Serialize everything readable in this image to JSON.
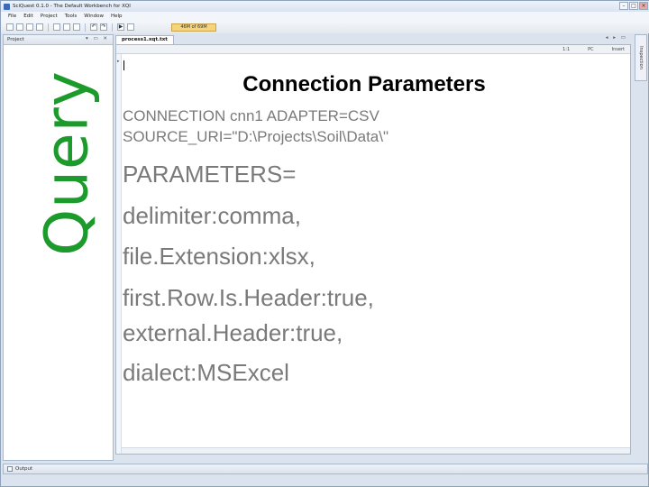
{
  "window": {
    "title": "SciQuest 0.1.0 - The Default Workbench for XQI"
  },
  "menu": [
    "File",
    "Edit",
    "Project",
    "Tools",
    "Window",
    "Help"
  ],
  "toolbar": {
    "memory": "46M of 69M"
  },
  "project_panel": {
    "title": "Project",
    "watermark": "Query"
  },
  "editor": {
    "tab_label": "process1.xqt.txt",
    "status": {
      "position": "1:1",
      "mode": "PC",
      "insert": "Insert"
    },
    "title": "Connection Parameters",
    "connection_lines": [
      "CONNECTION cnn1 ADAPTER=CSV",
      "SOURCE_URI=\"D:\\Projects\\Soil\\Data\\\""
    ],
    "parameter_lines": [
      "PARAMETERS=",
      "delimiter:comma,",
      "file.Extension:xlsx,",
      "first.Row.Is.Header:true,",
      "external.Header:true,",
      "dialect:MSExcel"
    ]
  },
  "inspection_tab": "Inspection",
  "output": {
    "label": "Output"
  },
  "colors": {
    "watermark": "#1d9a2c",
    "code_text": "#7a7a7a",
    "memory_bar": "#f6d47a"
  }
}
